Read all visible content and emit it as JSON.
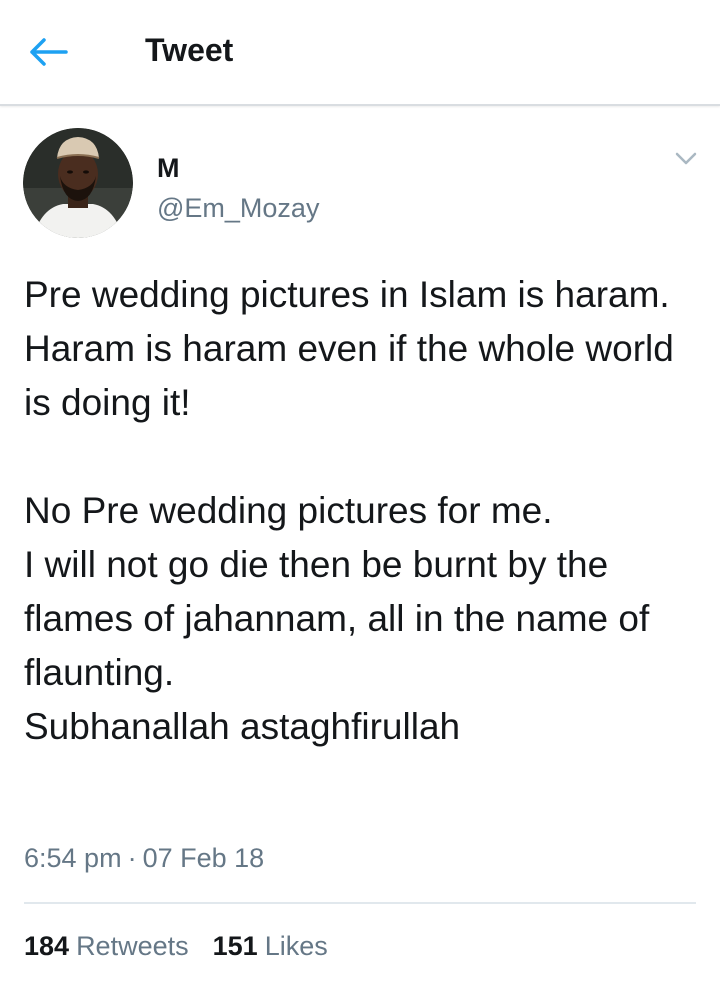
{
  "header": {
    "back_icon": "arrow-left-icon",
    "title": "Tweet",
    "accent_color": "#1da1f2"
  },
  "author": {
    "avatar_icon": "user-avatar",
    "display_name": "M",
    "handle": "@Em_Mozay",
    "menu_icon": "chevron-down-icon"
  },
  "tweet": {
    "text": "Pre wedding pictures in Islam is haram.\nHaram is haram even if the whole world is doing it!\n\nNo Pre wedding pictures for me.\nI will not go die then be burnt by the flames of jahannam, all in the name of flaunting.\nSubhanallah astaghfirullah",
    "time": "6:54 pm",
    "separator": "·",
    "date": "07 Feb 18"
  },
  "stats": {
    "retweets_count": "184",
    "retweets_label": "Retweets",
    "likes_count": "151",
    "likes_label": "Likes"
  }
}
